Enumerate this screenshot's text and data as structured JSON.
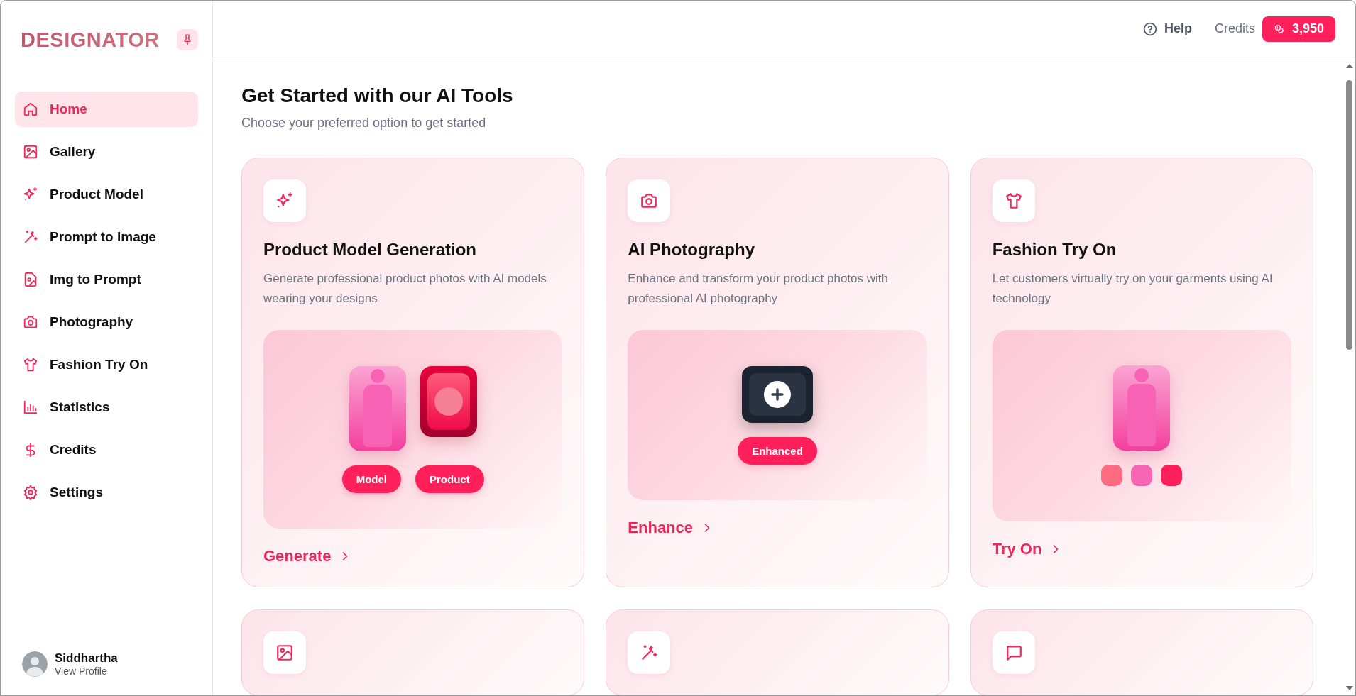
{
  "logo": {
    "text": "DESIGNATOR"
  },
  "sidebar": {
    "items": [
      {
        "label": "Home",
        "selected": true
      },
      {
        "label": "Gallery",
        "selected": false
      },
      {
        "label": "Product Model",
        "selected": false
      },
      {
        "label": "Prompt to Image",
        "selected": false
      },
      {
        "label": "Img to Prompt",
        "selected": false
      },
      {
        "label": "Photography",
        "selected": false
      },
      {
        "label": "Fashion Try On",
        "selected": false
      },
      {
        "label": "Statistics",
        "selected": false
      },
      {
        "label": "Credits",
        "selected": false
      },
      {
        "label": "Settings",
        "selected": false
      }
    ],
    "profile": {
      "name": "Siddhartha",
      "link": "View Profile"
    }
  },
  "header": {
    "help": "Help",
    "credits_label": "Credits",
    "credits": "3,950"
  },
  "page": {
    "title": "Get Started with our AI Tools",
    "subtitle": "Choose your preferred option to get started"
  },
  "cards": [
    {
      "kind": "model",
      "title": "Product Model Generation",
      "description": "Generate professional product photos with AI models wearing your designs",
      "tags": [
        "Model",
        "Product"
      ],
      "action": "Generate"
    },
    {
      "kind": "photo",
      "title": "AI Photography",
      "description": "Enhance and transform your product photos with professional AI photography",
      "tags": [
        "Enhanced"
      ],
      "action": "Enhance"
    },
    {
      "kind": "tryon",
      "title": "Fashion Try On",
      "description": "Let customers virtually try on your garments using AI technology",
      "swatches": [
        {
          "color": "#ff6b81"
        },
        {
          "color": "#f766b5"
        },
        {
          "color": "#ff1f5a"
        }
      ],
      "action": "Try On"
    },
    {
      "kind": "cut"
    },
    {
      "kind": "cut"
    },
    {
      "kind": "cut"
    }
  ]
}
